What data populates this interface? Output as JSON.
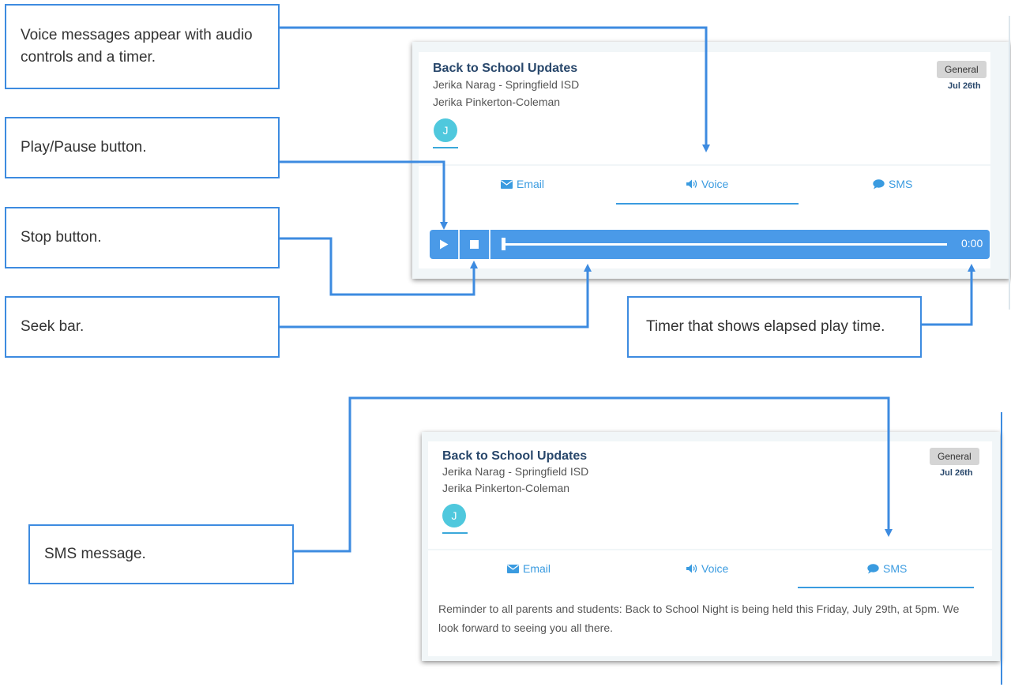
{
  "callouts": {
    "voice": "Voice messages appear with audio controls and a timer.",
    "play": "Play/Pause button.",
    "stop": "Stop button.",
    "seek": "Seek bar.",
    "timer": "Timer that shows elapsed play time.",
    "sms": "SMS message."
  },
  "card_voice": {
    "title": "Back to School Updates",
    "sender": "Jerika Narag - Springfield ISD",
    "recipient": "Jerika Pinkerton-Coleman",
    "badge": "General",
    "date": "Jul 26th",
    "avatar": "J",
    "tabs": {
      "email": "Email",
      "voice": "Voice",
      "sms": "SMS"
    },
    "active_tab": "voice",
    "player": {
      "time": "0:00",
      "progress": 0
    }
  },
  "card_sms": {
    "title": "Back to School Updates",
    "sender": "Jerika Narag - Springfield ISD",
    "recipient": "Jerika Pinkerton-Coleman",
    "badge": "General",
    "date": "Jul 26th",
    "avatar": "J",
    "tabs": {
      "email": "Email",
      "voice": "Voice",
      "sms": "SMS"
    },
    "active_tab": "sms",
    "message": "Reminder to all parents and students: Back to School Night is being held this Friday, July 29th, at 5pm. We look forward to seeing you all there."
  },
  "icons": {
    "email": "envelope-icon",
    "voice": "speaker-icon",
    "sms": "chat-bubble-icon",
    "play": "play-icon",
    "stop": "stop-icon"
  },
  "colors": {
    "accent": "#3a9be0",
    "callout_border": "#3d8be0",
    "player": "#4a9ae8",
    "title": "#28476b",
    "avatar": "#4fc8dd"
  }
}
